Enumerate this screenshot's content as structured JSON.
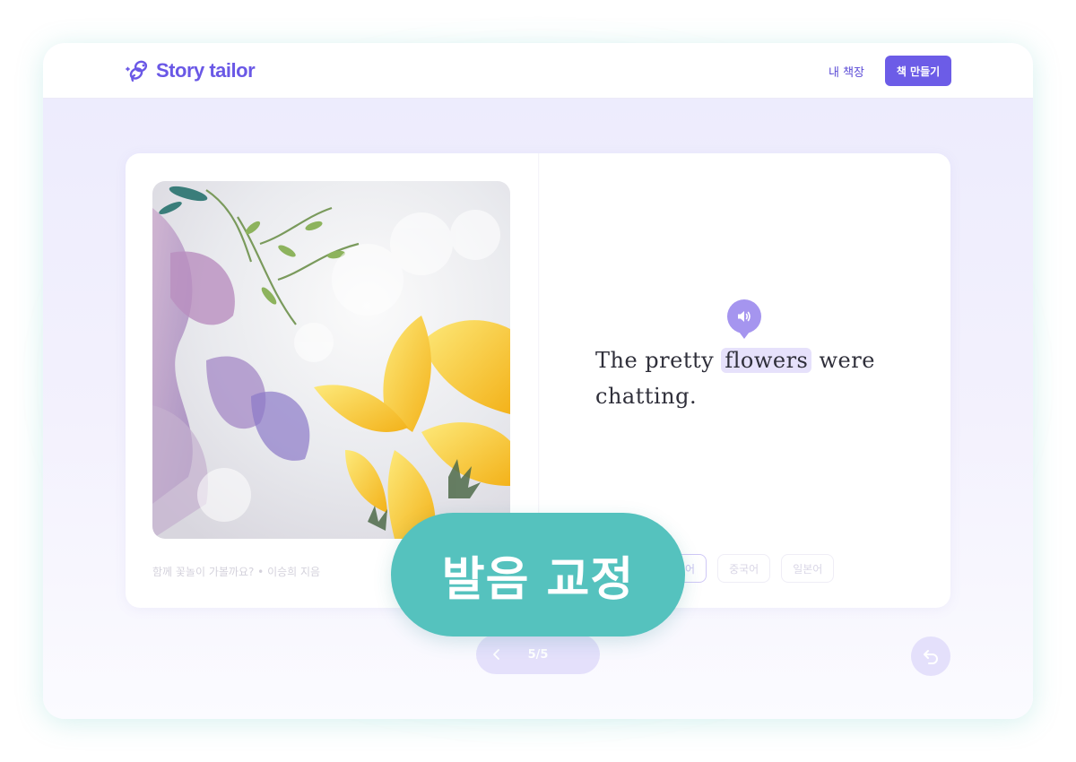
{
  "header": {
    "brand_name": "Story tailor",
    "nav_my_books": "내 책장",
    "create_book_label": "책 만들기"
  },
  "book": {
    "caption": "함께 꽃놀이 가볼까요? • 이승희 지음",
    "sentence_before": "The pretty ",
    "highlighted_word": "flowers",
    "sentence_after": " were chatting.",
    "languages": [
      "영어",
      "중국어",
      "일본어"
    ],
    "active_language_index": 0
  },
  "pager": {
    "page_label": "5/5"
  },
  "overlay": {
    "badge_label": "발음 교정"
  },
  "colors": {
    "brand": "#6c5ce7",
    "highlight": "#e6e1fb",
    "badge": "#55c2be"
  },
  "icons": {
    "logo": "bee-logo-icon",
    "speaker": "speaker-icon",
    "prev": "chevron-left-icon",
    "back": "undo-icon"
  }
}
